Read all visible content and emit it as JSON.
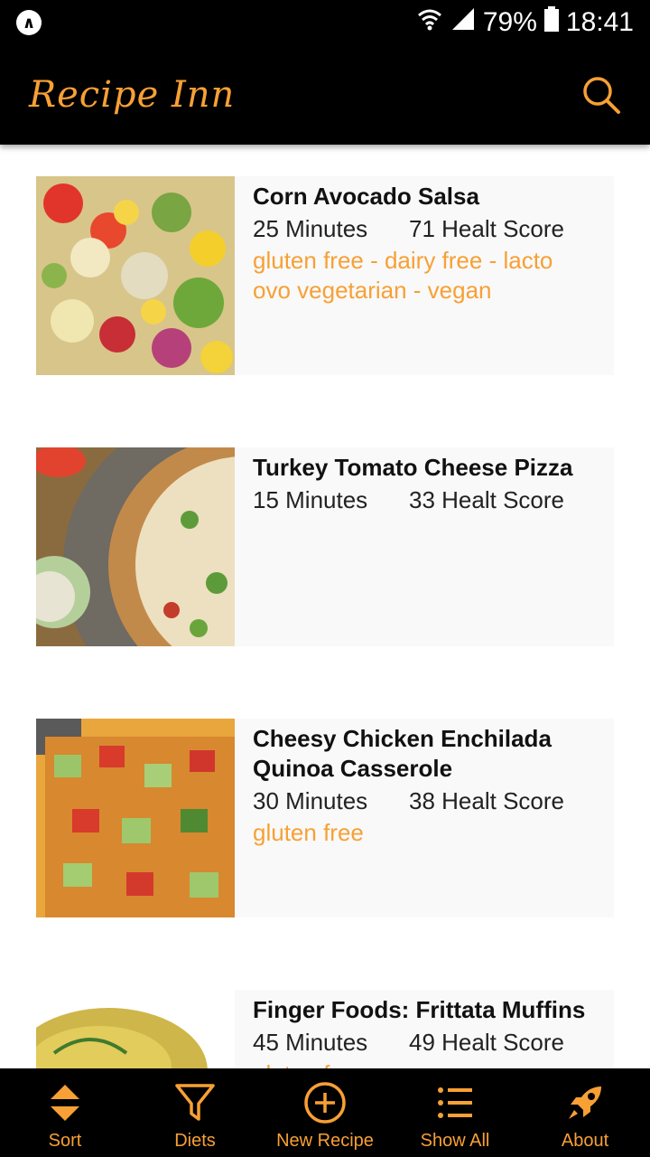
{
  "status_bar": {
    "battery": "79%",
    "time": "18:41",
    "app_badge": "∧"
  },
  "app_bar": {
    "title": "Recipe Inn"
  },
  "recipes": [
    {
      "title": "Corn Avocado Salsa",
      "minutes": "25 Minutes",
      "score": "71 Healt Score",
      "diets": "gluten free - dairy free - lacto ovo vegetarian - vegan"
    },
    {
      "title": "Turkey Tomato Cheese Pizza",
      "minutes": "15 Minutes",
      "score": "33 Healt Score",
      "diets": ""
    },
    {
      "title": "Cheesy Chicken Enchilada Quinoa Casserole",
      "minutes": "30 Minutes",
      "score": "38 Healt Score",
      "diets": "gluten free"
    },
    {
      "title": "Finger Foods: Frittata Muffins",
      "minutes": "45 Minutes",
      "score": "49 Healt Score",
      "diets": "gluten free"
    }
  ],
  "bottom_nav": [
    {
      "label": "Sort",
      "icon": "sort-icon"
    },
    {
      "label": "Diets",
      "icon": "filter-icon"
    },
    {
      "label": "New Recipe",
      "icon": "add-circle-icon"
    },
    {
      "label": "Show All",
      "icon": "list-icon"
    },
    {
      "label": "About",
      "icon": "rocket-icon"
    }
  ],
  "colors": {
    "accent": "#f7a035",
    "bar": "#000000",
    "card": "#f9f9f9"
  }
}
